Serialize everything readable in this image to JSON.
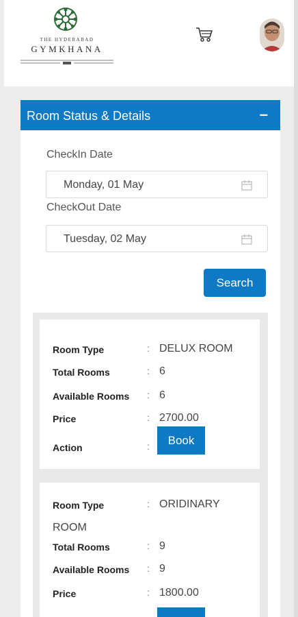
{
  "header": {
    "logo_small_text": "THE HYDERABAD",
    "logo_big_text": "GYMKHANA",
    "cart_icon": "cart-icon",
    "avatar_icon": "user-avatar"
  },
  "panel": {
    "title": "Room Status & Details",
    "collapse_symbol": "–",
    "checkin_label": "CheckIn Date",
    "checkin_value": "Monday, 01 May",
    "checkout_label": "CheckOut Date",
    "checkout_value": "Tuesday, 02 May",
    "search_label": "Search"
  },
  "rooms": [
    {
      "type_label": "Room Type",
      "type_value": "DELUX ROOM",
      "total_label": "Total Rooms",
      "total_value": "6",
      "available_label": "Available Rooms",
      "available_value": "6",
      "price_label": "Price",
      "price_value": "2700.00",
      "action_label": "Action",
      "book_label": "Book"
    },
    {
      "type_label": "Room Type",
      "type_value_line1": "ORIDINARY",
      "type_value_line2": "ROOM",
      "total_label": "Total Rooms",
      "total_value": "9",
      "available_label": "Available Rooms",
      "available_value": "9",
      "price_label": "Price",
      "price_value": "1800.00"
    }
  ],
  "colors": {
    "accent": "#0e7ac6",
    "background": "#ececec"
  }
}
